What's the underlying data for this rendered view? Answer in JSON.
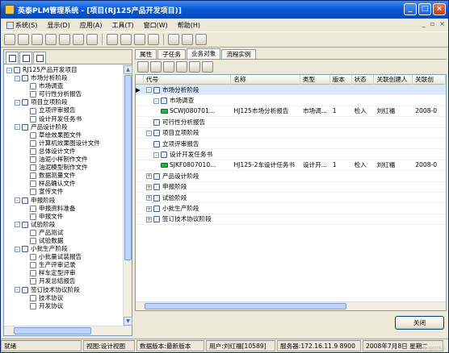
{
  "window": {
    "title": "英泰PLM管理系统 - [项目(RJ125产品开发项目)]"
  },
  "menu": [
    "系统(S)",
    "显示(D)",
    "应用(A)",
    "工具(T)",
    "窗口(W)",
    "帮助(H)"
  ],
  "right_tabs": [
    "属性",
    "子任务",
    "业务对象",
    "流程实例"
  ],
  "tree": [
    {
      "label": "RJ125产品开发项目",
      "level": 0,
      "pm": "-"
    },
    {
      "label": "市场分析阶段",
      "level": 1,
      "pm": "-"
    },
    {
      "label": "市场调查",
      "level": 2,
      "pm": ""
    },
    {
      "label": "可行性分析报告",
      "level": 2,
      "pm": ""
    },
    {
      "label": "项目立项阶段",
      "level": 1,
      "pm": "-"
    },
    {
      "label": "立项评审报告",
      "level": 2,
      "pm": ""
    },
    {
      "label": "设计开发任务书",
      "level": 2,
      "pm": ""
    },
    {
      "label": "产品设计阶段",
      "level": 1,
      "pm": "-"
    },
    {
      "label": "草绘效果图文件",
      "level": 2,
      "pm": ""
    },
    {
      "label": "计算机效果图设计文件",
      "level": 2,
      "pm": ""
    },
    {
      "label": "总体设计文件",
      "level": 2,
      "pm": ""
    },
    {
      "label": "油泥小样制作文件",
      "level": 2,
      "pm": ""
    },
    {
      "label": "油泥模型制作文件",
      "level": 2,
      "pm": ""
    },
    {
      "label": "数据测量文件",
      "level": 2,
      "pm": ""
    },
    {
      "label": "样品确认文件",
      "level": 2,
      "pm": ""
    },
    {
      "label": "宣传文件",
      "level": 2,
      "pm": ""
    },
    {
      "label": "申报阶段",
      "level": 1,
      "pm": "-"
    },
    {
      "label": "申报资料准备",
      "level": 2,
      "pm": ""
    },
    {
      "label": "申报文件",
      "level": 2,
      "pm": ""
    },
    {
      "label": "试验阶段",
      "level": 1,
      "pm": "-"
    },
    {
      "label": "产品测试",
      "level": 2,
      "pm": ""
    },
    {
      "label": "试验数据",
      "level": 2,
      "pm": ""
    },
    {
      "label": "小批生产阶段",
      "level": 1,
      "pm": "-"
    },
    {
      "label": "小批量试装报告",
      "level": 2,
      "pm": ""
    },
    {
      "label": "生产评审记录",
      "level": 2,
      "pm": ""
    },
    {
      "label": "样车定型评审",
      "level": 2,
      "pm": ""
    },
    {
      "label": "开发总结报告",
      "level": 2,
      "pm": ""
    },
    {
      "label": "签订技术协议阶段",
      "level": 1,
      "pm": "-"
    },
    {
      "label": "技术协议",
      "level": 2,
      "pm": ""
    },
    {
      "label": "开发协议",
      "level": 2,
      "pm": ""
    }
  ],
  "grid": {
    "columns": [
      "代号",
      "名称",
      "类型",
      "版本",
      "状态",
      "关联创建人",
      "关联创"
    ],
    "rows": [
      {
        "code": "市场分析阶段",
        "indent": 0,
        "pm": "-",
        "name": "",
        "type": "",
        "ver": "",
        "state": "",
        "creator": "",
        "cr": "",
        "selected": true
      },
      {
        "code": "市场调查",
        "indent": 1,
        "pm": "-",
        "name": "",
        "type": "",
        "ver": "",
        "state": "",
        "creator": "",
        "cr": ""
      },
      {
        "code": "SCWJ080701...",
        "indent": 2,
        "pm": "",
        "green": true,
        "name": "HJ125市场分析报告",
        "type": "市场调...",
        "ver": "1",
        "state": "检入",
        "creator": "刘红福",
        "cr": "2008-0"
      },
      {
        "code": "可行性分析报告",
        "indent": 1,
        "pm": "",
        "name": "",
        "type": "",
        "ver": "",
        "state": "",
        "creator": "",
        "cr": ""
      },
      {
        "code": "项目立项阶段",
        "indent": 0,
        "pm": "-",
        "name": "",
        "type": "",
        "ver": "",
        "state": "",
        "creator": "",
        "cr": ""
      },
      {
        "code": "立项评审报告",
        "indent": 1,
        "pm": "",
        "name": "",
        "type": "",
        "ver": "",
        "state": "",
        "creator": "",
        "cr": ""
      },
      {
        "code": "设计开发任务书",
        "indent": 1,
        "pm": "-",
        "name": "",
        "type": "",
        "ver": "",
        "state": "",
        "creator": "",
        "cr": ""
      },
      {
        "code": "SJKF0807010...",
        "indent": 2,
        "pm": "",
        "green": true,
        "name": "HJ125-2车设计任务书",
        "type": "设计开...",
        "ver": "1",
        "state": "检入",
        "creator": "刘红福",
        "cr": "2008-0"
      },
      {
        "code": "产品设计阶段",
        "indent": 0,
        "pm": "+",
        "name": "",
        "type": "",
        "ver": "",
        "state": "",
        "creator": "",
        "cr": ""
      },
      {
        "code": "申报阶段",
        "indent": 0,
        "pm": "+",
        "name": "",
        "type": "",
        "ver": "",
        "state": "",
        "creator": "",
        "cr": ""
      },
      {
        "code": "试验阶段",
        "indent": 0,
        "pm": "+",
        "name": "",
        "type": "",
        "ver": "",
        "state": "",
        "creator": "",
        "cr": ""
      },
      {
        "code": "小批生产阶段",
        "indent": 0,
        "pm": "+",
        "name": "",
        "type": "",
        "ver": "",
        "state": "",
        "creator": "",
        "cr": ""
      },
      {
        "code": "签订技术协议阶段",
        "indent": 0,
        "pm": "+",
        "name": "",
        "type": "",
        "ver": "",
        "state": "",
        "creator": "",
        "cr": ""
      }
    ]
  },
  "close_label": "关闭",
  "status": [
    "就绪",
    "视图:设计视图",
    "数据版本:最新版本",
    "用户:刘红福[10589]",
    "服务器:172.16.11.9 8900",
    "2008年7月8日 星期二"
  ],
  "watermark": "e-works"
}
